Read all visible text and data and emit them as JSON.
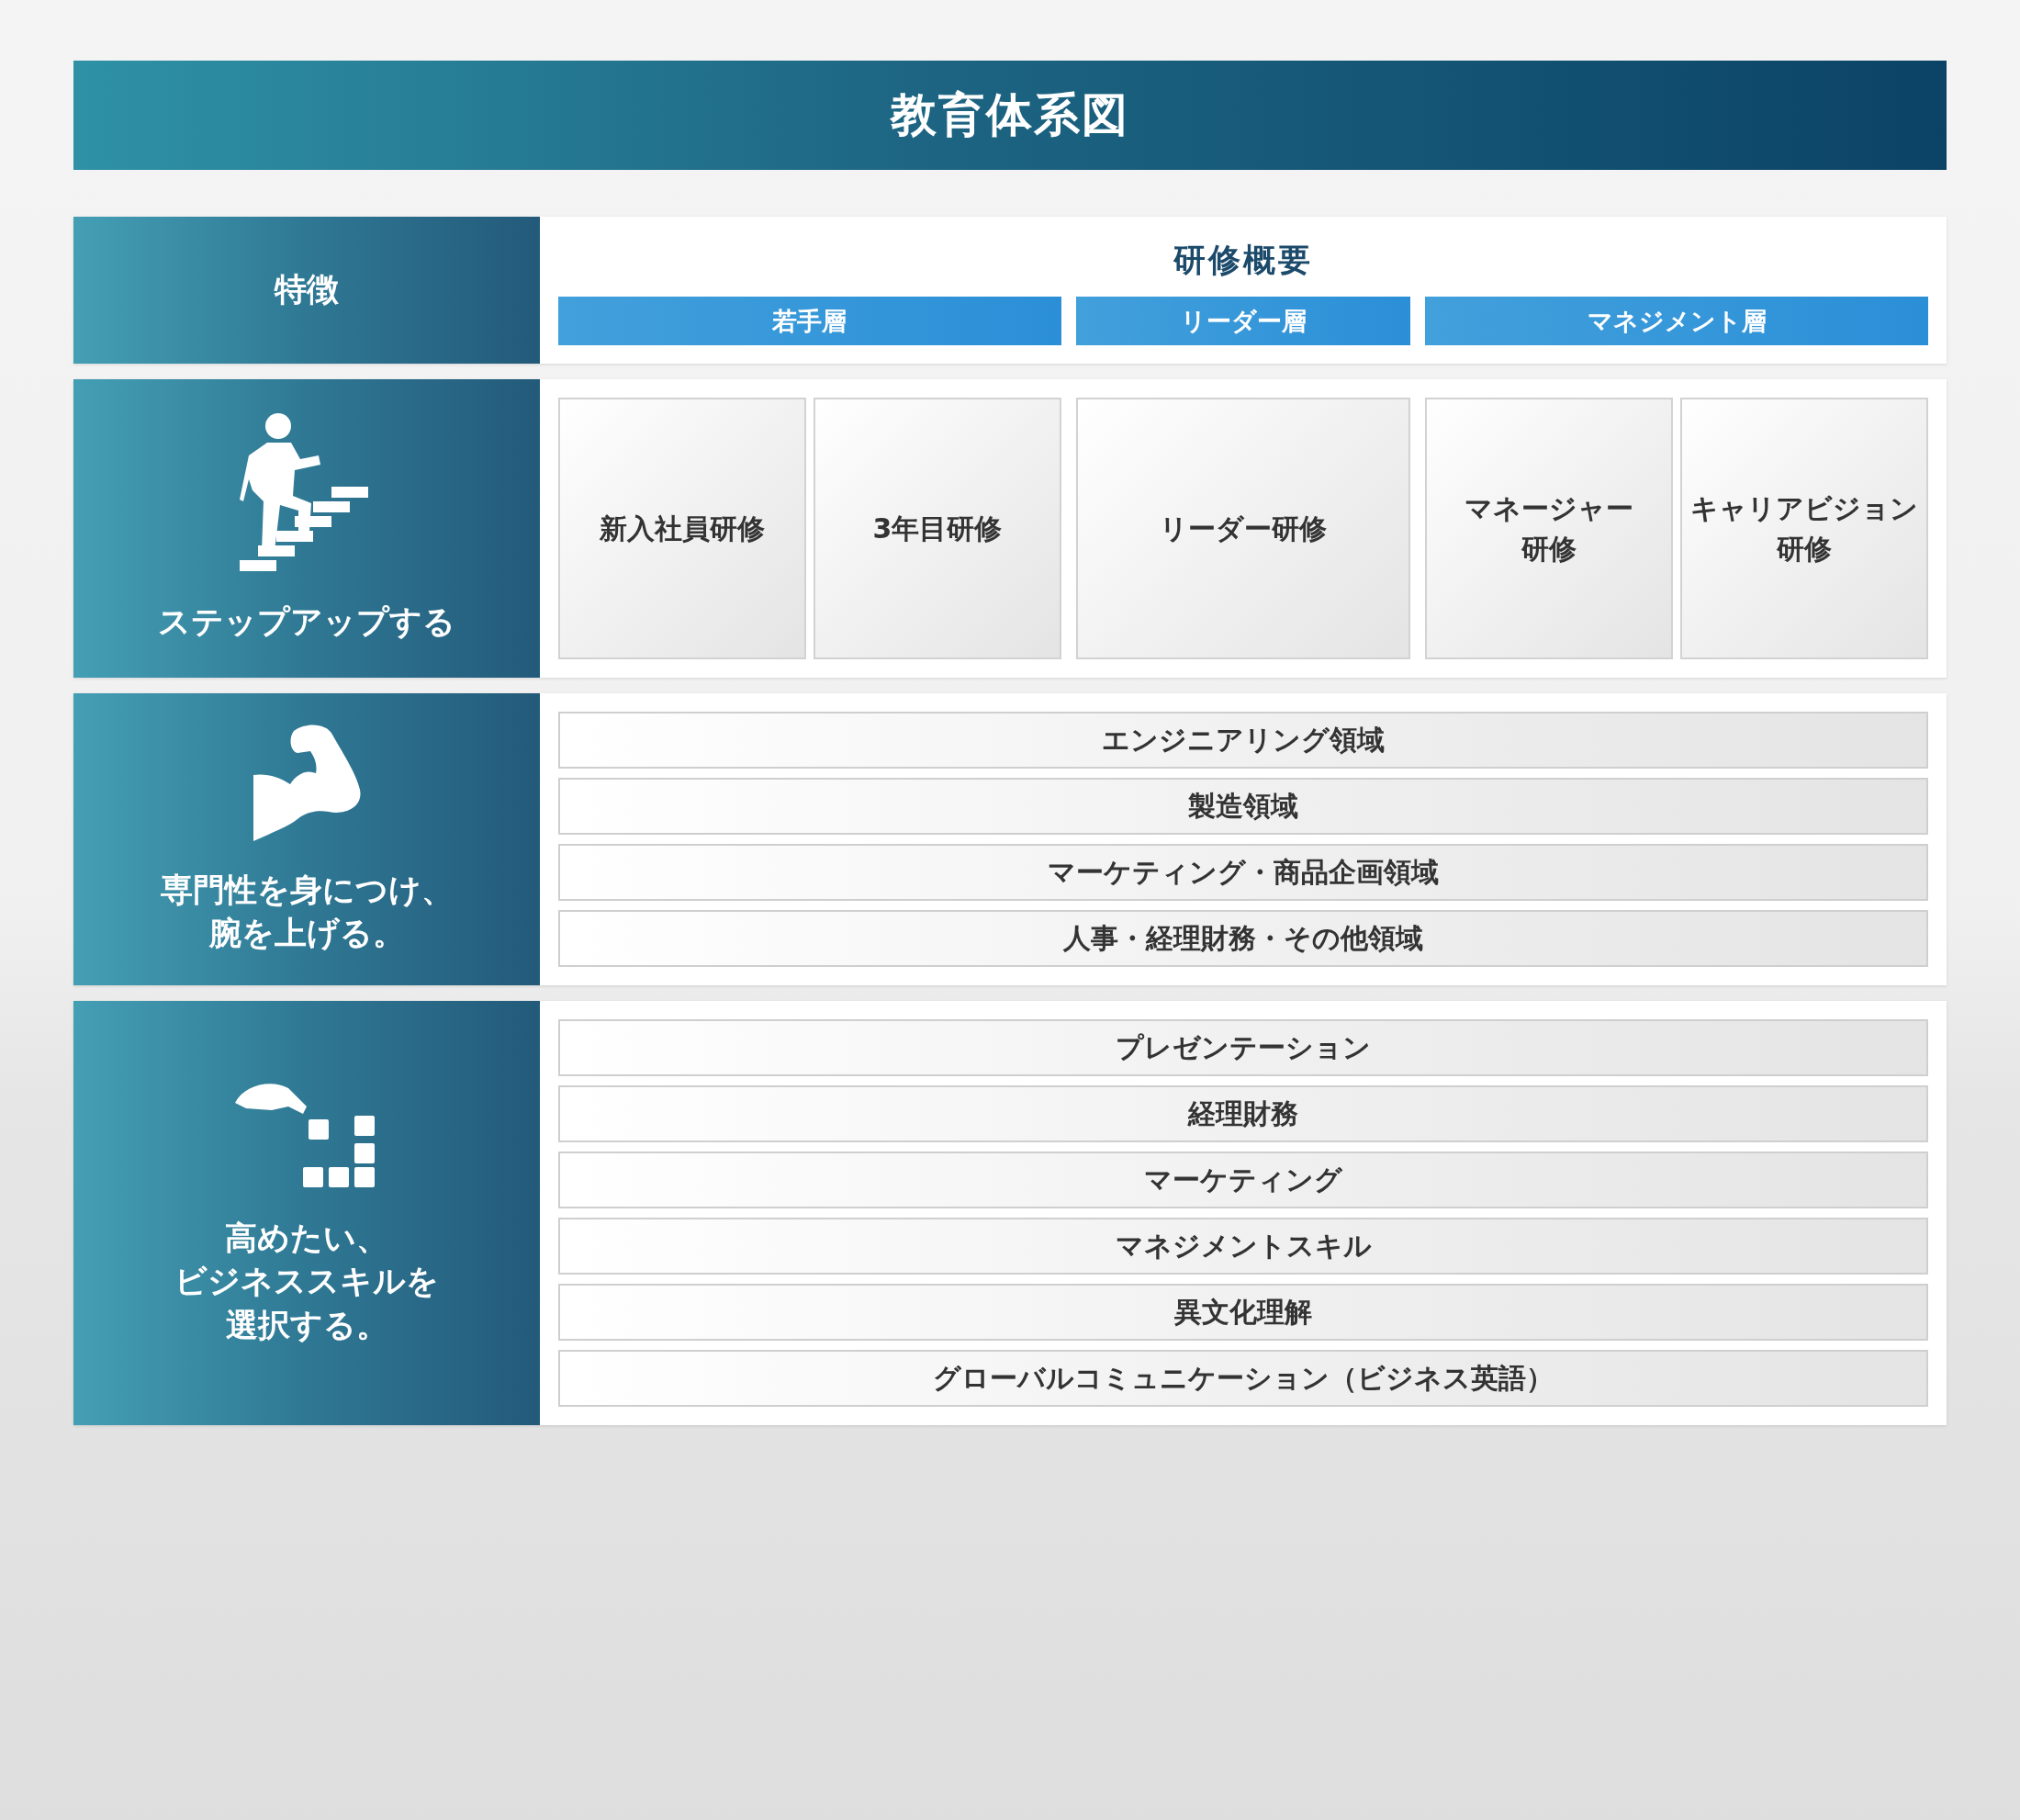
{
  "title": "教育体系図",
  "header": {
    "feature_label": "特徴",
    "overview_title": "研修概要"
  },
  "tiers": [
    {
      "label": "若手層",
      "courses": [
        [
          "新入社員研修"
        ],
        [
          "3年目研修"
        ]
      ]
    },
    {
      "label": "リーダー層",
      "courses": [
        [
          "リーダー研修"
        ]
      ]
    },
    {
      "label": "マネジメント層",
      "courses": [
        [
          "マネージャー",
          "研修"
        ],
        [
          "キャリアビジョン",
          "研修"
        ]
      ]
    }
  ],
  "rows": [
    {
      "kind": "steps",
      "caption": [
        "ステップアップする"
      ]
    },
    {
      "kind": "list",
      "caption": [
        "専門性を身につけ、",
        "腕を上げる。"
      ],
      "items": [
        "エンジニアリング領域",
        "製造領域",
        "マーケティング・商品企画領域",
        "人事・経理財務・その他領域"
      ]
    },
    {
      "kind": "list",
      "caption": [
        "高めたい、",
        "ビジネススキルを",
        "選択する。"
      ],
      "items": [
        "プレゼンテーション",
        "経理財務",
        "マーケティング",
        "マネジメントスキル",
        "異文化理解",
        "グローバルコミュニケーション（ビジネス英語）"
      ]
    }
  ]
}
